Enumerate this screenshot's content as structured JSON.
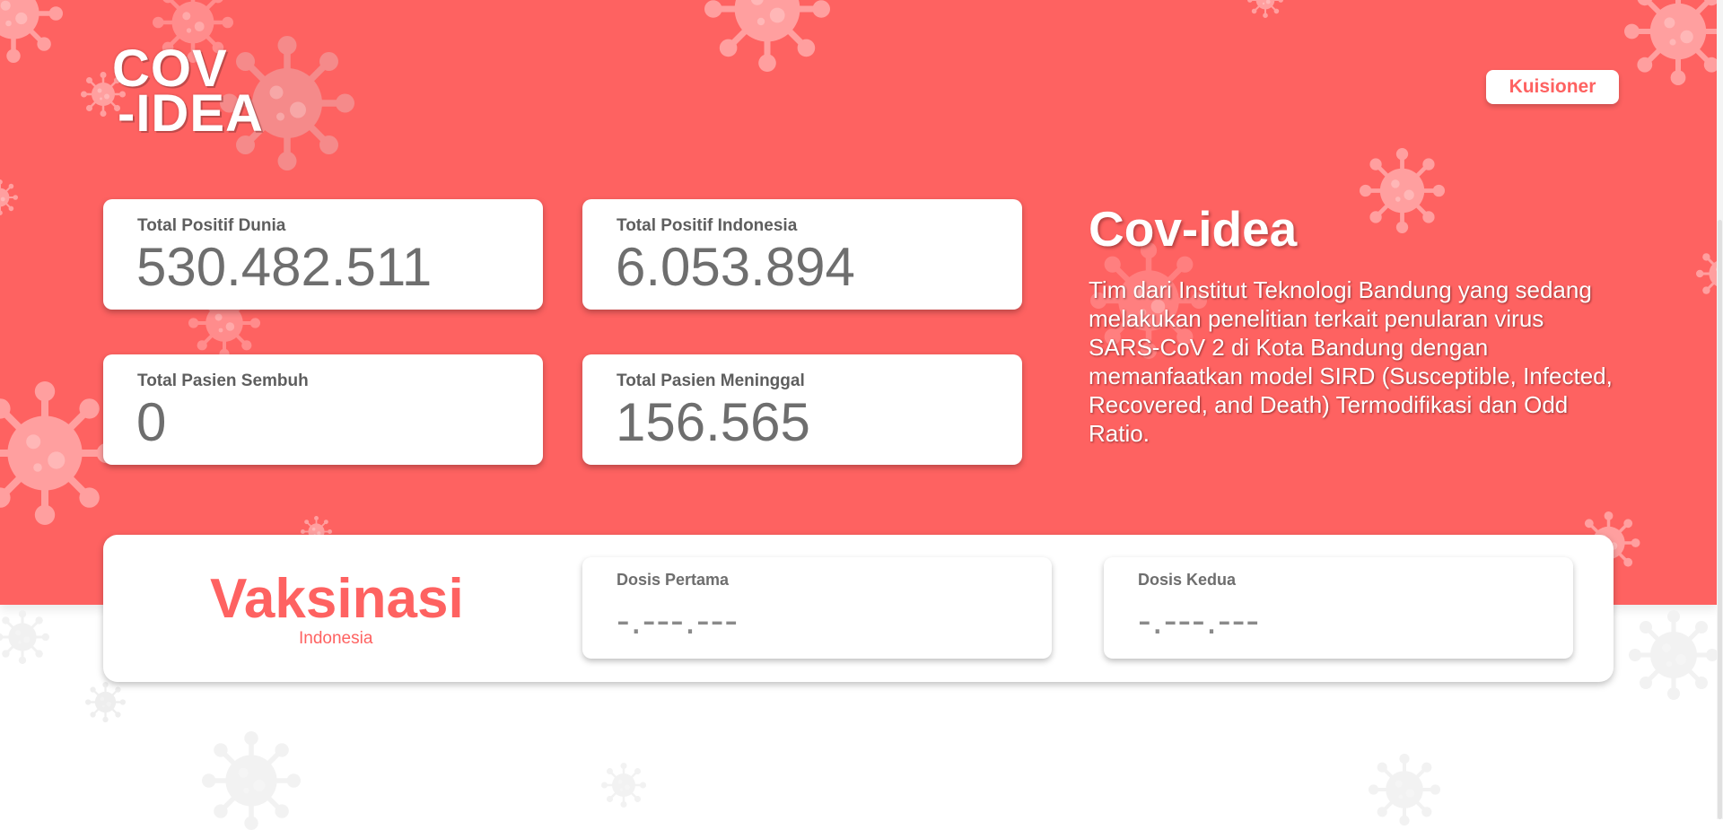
{
  "logo": {
    "line1": "COV",
    "line2": "-IDEA"
  },
  "header": {
    "kuisioner_label": "Kuisioner"
  },
  "stats": [
    {
      "label": "Total Positif Dunia",
      "value": "530.482.511"
    },
    {
      "label": "Total Positif Indonesia",
      "value": "6.053.894"
    },
    {
      "label": "Total Pasien Sembuh",
      "value": "0"
    },
    {
      "label": "Total Pasien Meninggal",
      "value": "156.565"
    }
  ],
  "about": {
    "title": "Cov-idea",
    "text": "Tim dari Institut Teknologi Bandung yang sedang melakukan penelitian terkait penularan virus SARS-CoV 2 di Kota Bandung dengan memanfaatkan model SIRD (Susceptible, Infected, Recovered, and Death) Termodifikasi dan Odd Ratio."
  },
  "vaccination": {
    "title": "Vaksinasi",
    "subtitle": "Indonesia",
    "doses": [
      {
        "label": "Dosis Pertama",
        "value": "-.---.---"
      },
      {
        "label": "Dosis Kedua",
        "value": "-.---.---"
      }
    ]
  },
  "colors": {
    "primary": "#fe6261",
    "card_text": "#6e6e6e",
    "decor_light": "#ff9f9f"
  }
}
